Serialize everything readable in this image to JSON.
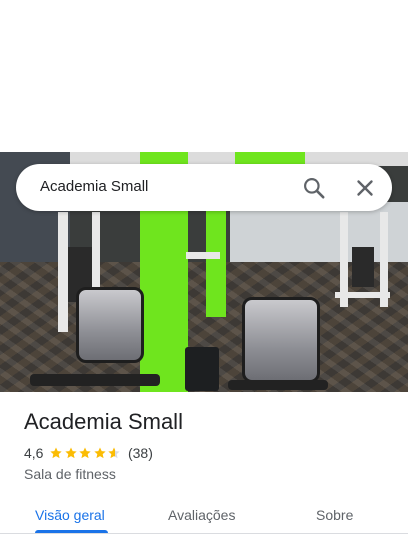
{
  "search": {
    "query": "Academia Small"
  },
  "place": {
    "name": "Academia Small",
    "rating": "4,6",
    "rating_value": 4.6,
    "review_count": "(38)",
    "category": "Sala de fitness"
  },
  "tabs": [
    {
      "label": "Visão geral",
      "active": true
    },
    {
      "label": "Avaliações",
      "active": false
    },
    {
      "label": "Sobre",
      "active": false
    }
  ],
  "icons": {
    "search": "search-icon",
    "close": "close-icon",
    "star": "star-icon"
  },
  "colors": {
    "accent": "#1a73e8",
    "star": "#fbbc04",
    "text_primary": "#202124",
    "text_secondary": "#5f6368"
  }
}
